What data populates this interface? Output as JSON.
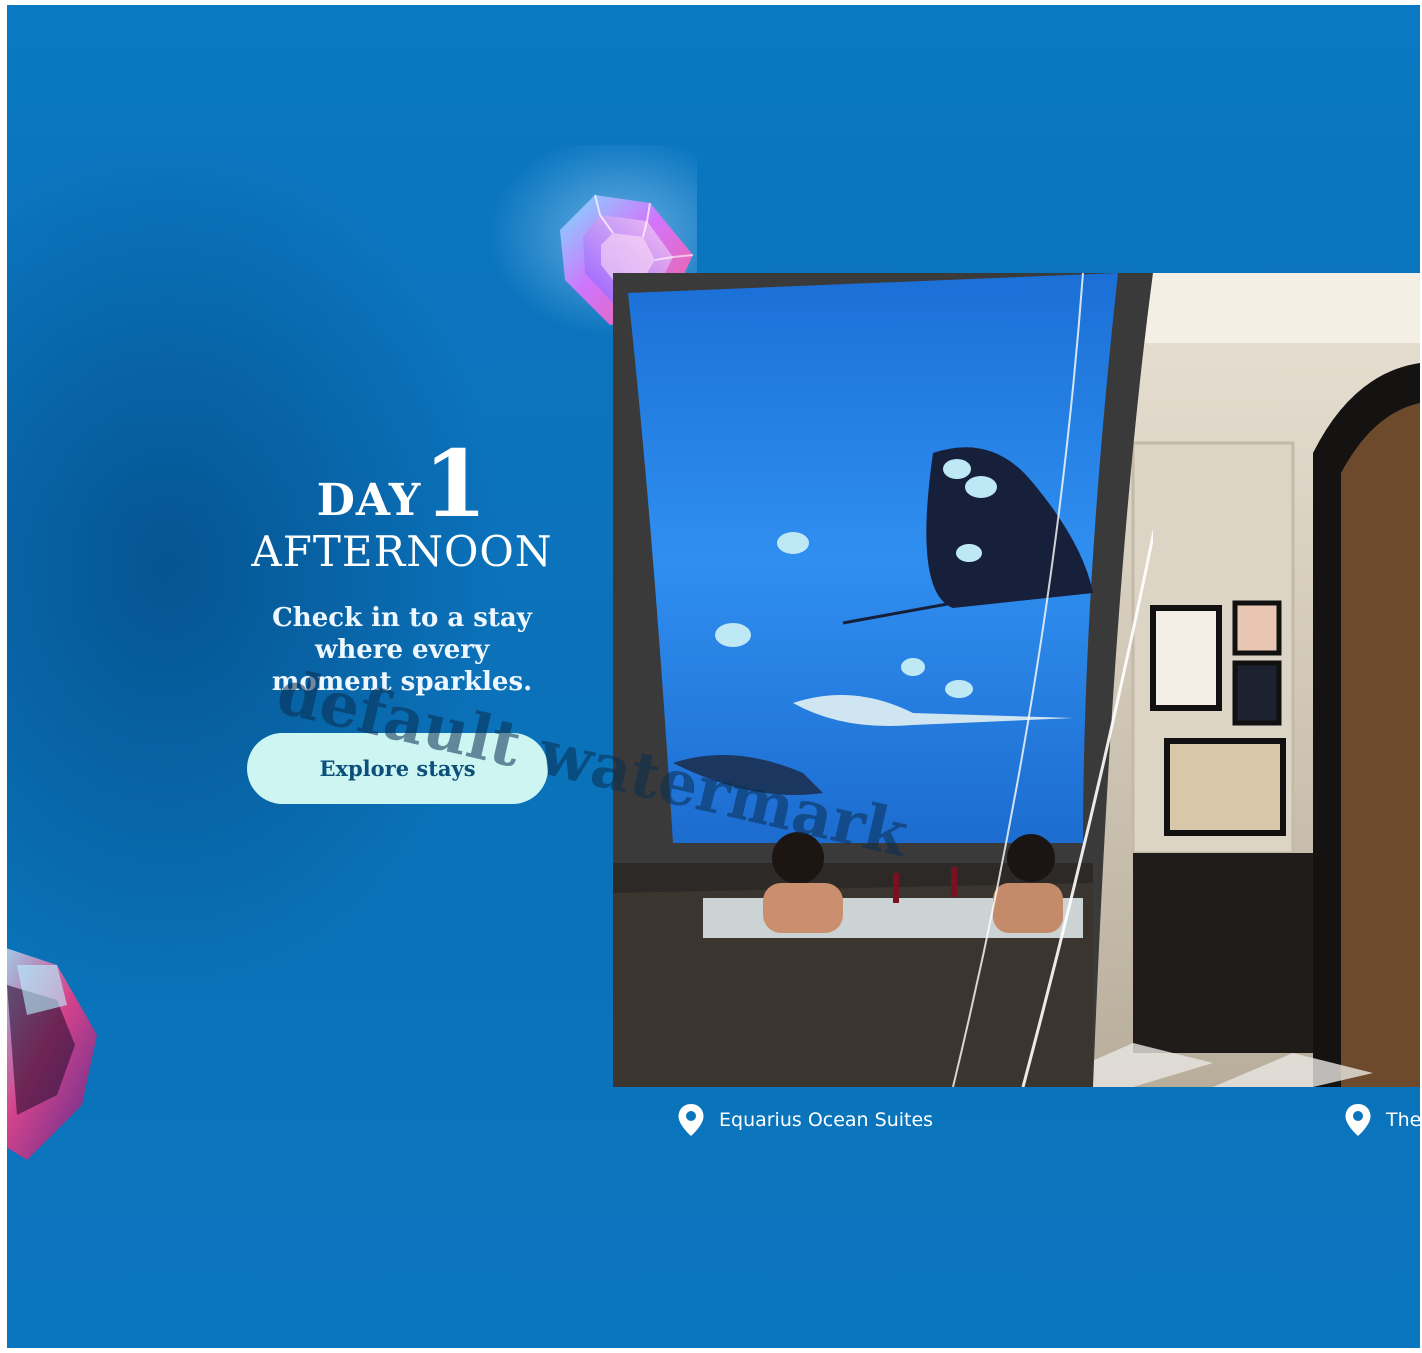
{
  "hero": {
    "day_word": "DAY",
    "day_number": "1",
    "time_of_day": "AFTERNOON",
    "tagline_lines": [
      "Check in to a stay",
      "where every",
      "moment sparkles."
    ],
    "cta_label": "Explore stays"
  },
  "gallery": {
    "items": [
      {
        "caption": "Equarius Ocean Suites",
        "icon": "location-pin-icon"
      },
      {
        "caption": "The",
        "icon": "location-pin-icon"
      }
    ]
  },
  "overlay": {
    "watermark": "default watermark"
  },
  "colors": {
    "background": "#0a74bd",
    "cta_background": "#cdf6f3",
    "cta_text": "#0b4f7a",
    "text": "#ffffff"
  }
}
